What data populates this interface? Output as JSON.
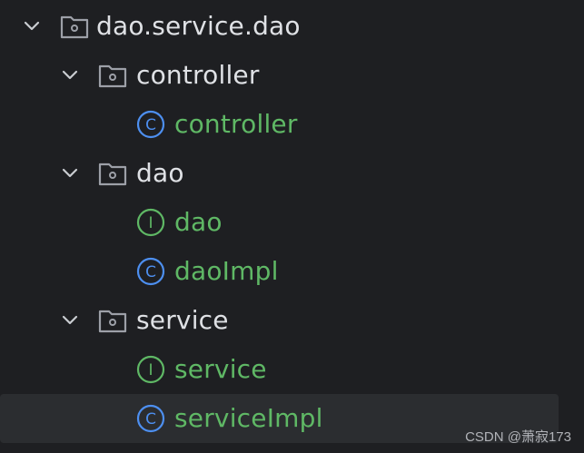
{
  "tree": {
    "root": {
      "label": "dao.service.dao",
      "expanded": true
    },
    "controller_pkg": {
      "label": "controller",
      "expanded": true
    },
    "controller_class": {
      "label": "controller",
      "kind": "class"
    },
    "dao_pkg": {
      "label": "dao",
      "expanded": true
    },
    "dao_interface": {
      "label": "dao",
      "kind": "interface"
    },
    "daoimpl_class": {
      "label": "daoImpl",
      "kind": "class"
    },
    "service_pkg": {
      "label": "service",
      "expanded": true
    },
    "service_interface": {
      "label": "service",
      "kind": "interface"
    },
    "serviceimpl_class": {
      "label": "serviceImpl",
      "kind": "class",
      "selected": true
    }
  },
  "watermark": "CSDN @萧寂173",
  "colors": {
    "background": "#1e1f22",
    "selected_row": "#2b2d30",
    "package_text": "#dfe1e5",
    "java_text": "#5fb865",
    "class_icon": "#4d8ff0",
    "interface_icon": "#5fb865",
    "folder_icon": "#9da0a8"
  }
}
